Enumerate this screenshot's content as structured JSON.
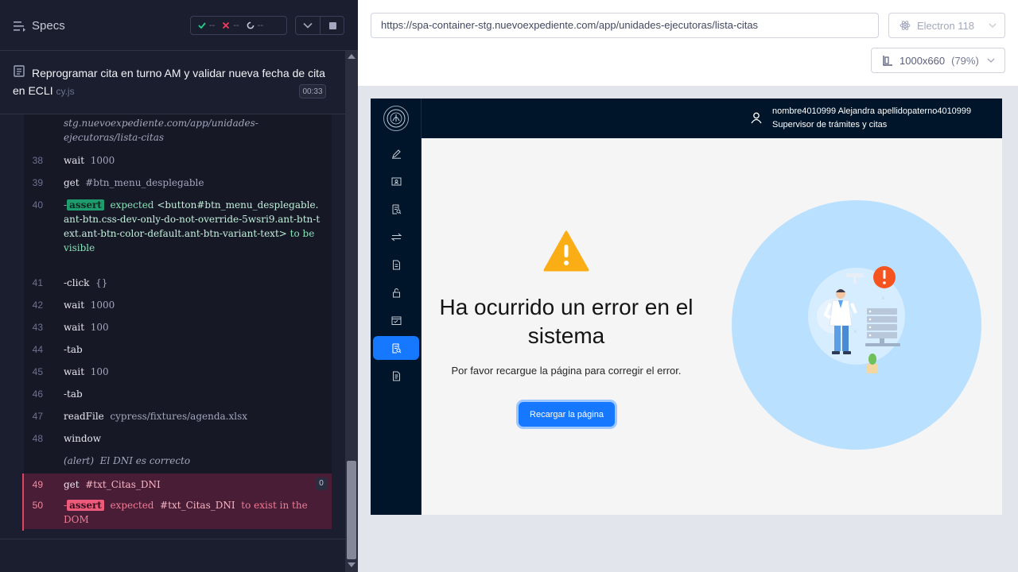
{
  "reporter": {
    "specs_label": "Specs",
    "stats": {
      "passed": "--",
      "failed": "--",
      "pending": "--"
    },
    "test": {
      "title": "Reprogramar cita en turno AM y validar nueva fecha de cita en ECLI",
      "file": "cy.js",
      "duration": "00:33"
    },
    "commands": {
      "url_cont_1": "stg.nuevoexpediente.com/app/unidades-",
      "url_cont_2": "ejecutoras/lista-citas",
      "c38": {
        "num": "38",
        "name": "wait",
        "arg": "1000"
      },
      "c39": {
        "num": "39",
        "name": "get",
        "arg": "#btn_menu_desplegable"
      },
      "c40": {
        "num": "40",
        "prefix": "-",
        "badge": "assert",
        "expected": "expected",
        "sel": "<button#btn_menu_desplegable.ant-btn.css-dev-only-do-not-override-5wsri9.ant-btn-text.ant-btn-color-default.ant-btn-variant-text>",
        "tail": "to be",
        "tail2": "visible"
      },
      "c41": {
        "num": "41",
        "name": "-click",
        "arg": "{}"
      },
      "c42": {
        "num": "42",
        "name": "wait",
        "arg": "1000"
      },
      "c43": {
        "num": "43",
        "name": "wait",
        "arg": "100"
      },
      "c44": {
        "num": "44",
        "name": "-tab",
        "arg": ""
      },
      "c45": {
        "num": "45",
        "name": "wait",
        "arg": "100"
      },
      "c46": {
        "num": "46",
        "name": "-tab",
        "arg": ""
      },
      "c47": {
        "num": "47",
        "name": "readFile",
        "arg": "cypress/fixtures/agenda.xlsx"
      },
      "c48": {
        "num": "48",
        "name": "window",
        "arg": ""
      },
      "alert": {
        "name": "(alert)",
        "arg": "El DNI es correcto"
      },
      "c49": {
        "num": "49",
        "name": "get",
        "arg": "#txt_Citas_DNI",
        "count": "0"
      },
      "c50": {
        "num": "50",
        "prefix": "-",
        "badge": "assert",
        "expected": "expected",
        "sel": "#txt_Citas_DNI",
        "tail": "to exist in",
        "tail2": "the DOM"
      }
    }
  },
  "runner": {
    "url": "https://spa-container-stg.nuevoexpediente.com/app/unidades-ejecutoras/lista-citas",
    "browser": "Electron 118",
    "viewport": "1000x660",
    "zoom": "(79%)"
  },
  "aut": {
    "user_name": "nombre4010999 Alejandra apellidopaterno4010999",
    "user_role": "Supervisor de trámites y citas",
    "error_title": "Ha ocurrido un error en el sistema",
    "error_subtitle": "Por favor recargue la página para corregir el error.",
    "reload_button": "Recargar la página"
  },
  "colors": {
    "accent": "#1677ff",
    "fail": "#e0435e",
    "pass": "#1f9c6d",
    "sidebar": "#001529"
  }
}
